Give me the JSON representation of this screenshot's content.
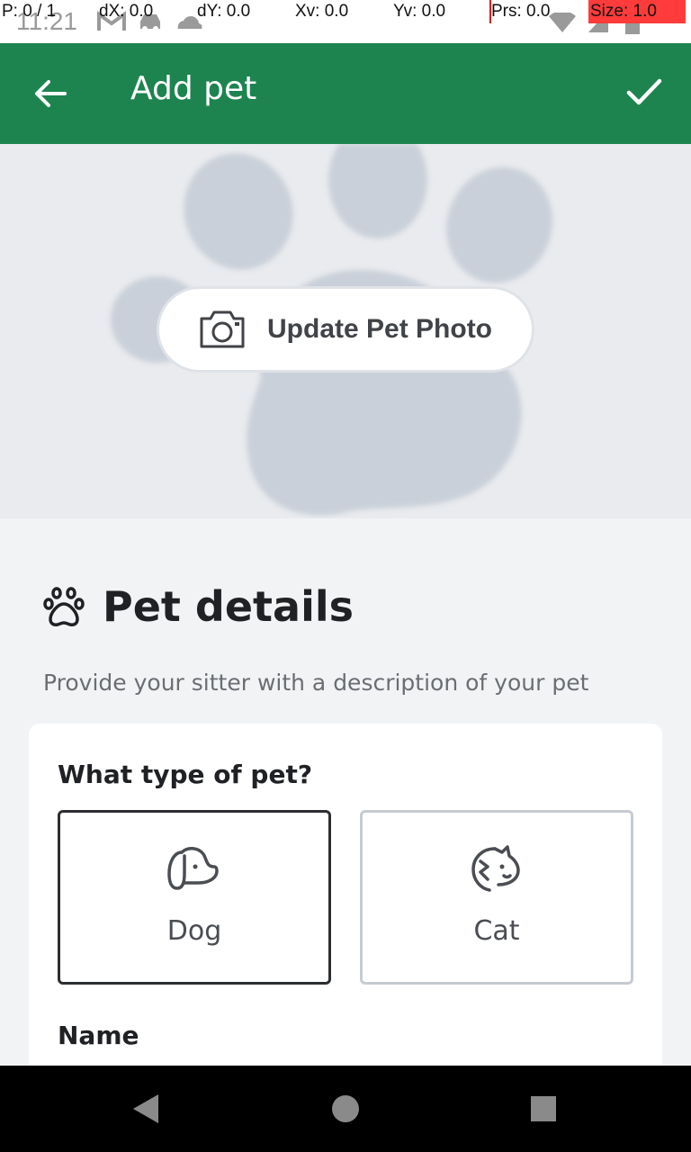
{
  "status_bar": {
    "time": "11:21",
    "debug": {
      "pointer": "P: 0 / 1",
      "dx": "dX: 0.0",
      "dy": "dY: 0.0",
      "xv": "Xv: 0.0",
      "yv": "Yv: 0.0",
      "prs": "Prs: 0.0",
      "size": "Size: 1.0"
    },
    "icons": [
      "gmail-icon",
      "car-icon",
      "cloud-icon",
      "wifi-icon",
      "signal-icon",
      "battery-icon"
    ]
  },
  "app_bar": {
    "title": "Add pet",
    "back_icon": "arrow-left-icon",
    "confirm_icon": "check-icon",
    "color": "#1d8450"
  },
  "photo": {
    "button_label": "Update Pet Photo",
    "icon": "camera-icon",
    "placeholder_icon": "paw-icon"
  },
  "pet_details": {
    "title": "Pet details",
    "icon": "paw-icon",
    "description": "Provide your sitter with a description of your pet",
    "type_question": "What type of pet?",
    "options": [
      {
        "label": "Dog",
        "icon": "dog-icon",
        "selected": true
      },
      {
        "label": "Cat",
        "icon": "cat-icon",
        "selected": false
      }
    ],
    "name_label": "Name"
  },
  "nav_bar": {
    "icons": [
      "back-triangle-icon",
      "home-circle-icon",
      "recents-square-icon"
    ]
  }
}
